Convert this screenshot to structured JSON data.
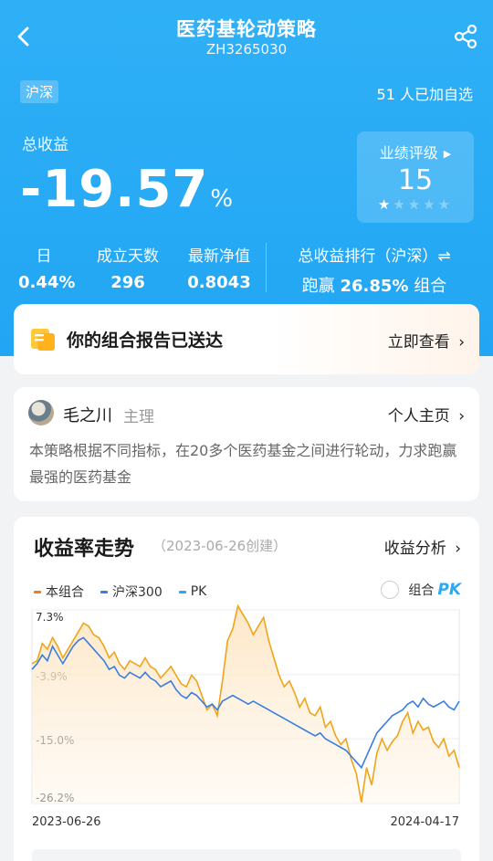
{
  "header": {
    "title": "医药基轮动策略",
    "code": "ZH3265030",
    "market_tag": "沪深",
    "watch_count": "51 人已加自选"
  },
  "summary": {
    "total_label": "总收益",
    "total_value": "-19.57",
    "total_unit": "%",
    "rating_label": "业绩评级",
    "rating_value": "15",
    "rating_stars": 1,
    "rating_stars_max": 5
  },
  "stats": [
    {
      "label": "日",
      "value": "0.44%"
    },
    {
      "label": "成立天数",
      "value": "296"
    },
    {
      "label": "最新净值",
      "value": "0.8043"
    }
  ],
  "rank": {
    "label": "总收益排行（沪深）⇌",
    "prefix": "跑赢",
    "value": "26.85%",
    "suffix": "组合"
  },
  "report": {
    "text": "你的组合报告已送达",
    "link": "立即查看"
  },
  "manager": {
    "name": "毛之川",
    "role": "主理",
    "home_link": "个人主页",
    "description": "本策略根据不同指标，在20多个医药基金之间进行轮动，力求跑赢最强的医药基金"
  },
  "chart_section": {
    "title": "收益率走势",
    "subtitle": "（2023-06-26创建）",
    "analysis_link": "收益分析",
    "pk_label": "组合",
    "pk_badge": "PK"
  },
  "colors": {
    "hero": "#22a6f4",
    "portfolio": "#f0a419",
    "index": "#3a7de0",
    "pk": "#2ea8f5"
  },
  "chart_data": {
    "type": "line",
    "x_labels": [
      "2023-06-26",
      "2024-04-17"
    ],
    "y_ticks": [
      "7.3%",
      "-3.9%",
      "-15.0%",
      "-26.2%"
    ],
    "ylim": [
      -26.2,
      7.3
    ],
    "legend": [
      "本组合",
      "沪深300",
      "PK"
    ],
    "series": [
      {
        "name": "本组合",
        "values": [
          -2.0,
          -1.5,
          1.5,
          0.5,
          2.5,
          1.0,
          -1.0,
          0.5,
          2.0,
          3.5,
          5.0,
          4.5,
          3.0,
          2.5,
          1.0,
          -1.0,
          0.0,
          -2.0,
          -3.0,
          -1.5,
          -2.0,
          -2.5,
          -1.0,
          -2.5,
          -3.0,
          -4.5,
          -3.5,
          -2.5,
          -4.0,
          -5.5,
          -6.0,
          -4.0,
          -5.0,
          -7.5,
          -10.0,
          -9.0,
          -11.0,
          -5.0,
          2.0,
          4.0,
          8.0,
          6.5,
          5.0,
          3.0,
          4.5,
          6.0,
          2.0,
          -1.0,
          -4.0,
          -6.0,
          -5.0,
          -7.0,
          -9.5,
          -8.0,
          -10.5,
          -11.0,
          -9.5,
          -13.0,
          -12.0,
          -14.5,
          -16.0,
          -15.0,
          -18.5,
          -21.0,
          -26.0,
          -20.0,
          -23.0,
          -17.5,
          -15.0,
          -17.0,
          -15.5,
          -14.5,
          -12.0,
          -10.5,
          -14.0,
          -12.0,
          -13.5,
          -13.0,
          -15.5,
          -16.5,
          -15.0,
          -18.0,
          -17.0,
          -20.0
        ]
      },
      {
        "name": "沪深300",
        "values": [
          -3.0,
          -2.0,
          -0.5,
          -1.5,
          1.0,
          -0.5,
          -2.0,
          -0.5,
          1.0,
          2.0,
          2.5,
          1.5,
          0.5,
          -0.5,
          -1.5,
          -3.0,
          -2.5,
          -4.0,
          -4.5,
          -3.5,
          -4.0,
          -4.5,
          -3.5,
          -4.5,
          -5.0,
          -6.0,
          -5.5,
          -5.0,
          -6.5,
          -7.5,
          -8.0,
          -7.0,
          -7.5,
          -8.5,
          -9.5,
          -9.0,
          -10.0,
          -8.5,
          -8.0,
          -7.5,
          -8.0,
          -8.5,
          -9.0,
          -8.5,
          -9.0,
          -9.5,
          -10.0,
          -10.5,
          -11.0,
          -11.5,
          -12.0,
          -12.5,
          -13.0,
          -13.5,
          -14.0,
          -14.5,
          -14.0,
          -15.0,
          -15.5,
          -16.0,
          -16.5,
          -17.0,
          -18.0,
          -19.0,
          -20.0,
          -18.0,
          -16.0,
          -14.0,
          -13.0,
          -12.0,
          -11.0,
          -10.5,
          -10.0,
          -9.0,
          -8.5,
          -9.5,
          -8.0,
          -9.0,
          -9.5,
          -9.0,
          -8.5,
          -9.5,
          -10.0,
          -8.5
        ]
      }
    ]
  }
}
